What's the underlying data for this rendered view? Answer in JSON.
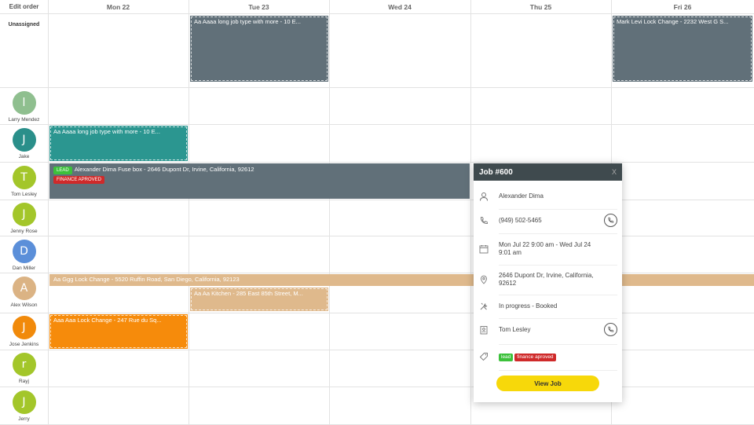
{
  "header": {
    "edit_order": "Edit order",
    "days": [
      "Mon 22",
      "Tue 23",
      "Wed 24",
      "Thu 25",
      "Fri 26"
    ]
  },
  "unassigned_label": "Unassigned",
  "technicians": [
    {
      "name": "Larry Mendez",
      "initial": "l",
      "color": "#8fbf8f"
    },
    {
      "name": "Jake",
      "initial": "J",
      "color": "#2a8f8a"
    },
    {
      "name": "Tom Lesley",
      "initial": "T",
      "color": "#a3c62a"
    },
    {
      "name": "Jenny Rose",
      "initial": "J",
      "color": "#a3c62a"
    },
    {
      "name": "Dan Miller",
      "initial": "D",
      "color": "#5b8fd9"
    },
    {
      "name": "Alex Wilson",
      "initial": "A",
      "color": "#dbb384"
    },
    {
      "name": "Jose Jenkins",
      "initial": "J",
      "color": "#f18a0b"
    },
    {
      "name": "Rayj",
      "initial": "r",
      "color": "#a3c62a"
    },
    {
      "name": "Jerry",
      "initial": "J",
      "color": "#a3c62a"
    }
  ],
  "jobs": {
    "unassigned_tue": "Aa Aaaa long job type with more - 10 E...",
    "unassigned_fri": "Mark Levi Lock Change - 2232 West G S...",
    "jake_mon": "Aa Aaaa long job type with more - 10 E...",
    "tom_job": "Alexander Dima Fuse box - 2646 Dupont Dr, Irvine, California, 92612",
    "tom_tag_lead": "LEAD",
    "tom_tag_finance": "FINANCE APROVED",
    "alex_long": "Aa Ggg Lock Change - 5520 Ruffin Road, San Diego, California, 92123",
    "alex_tue": "Aa Aa Kitchen - 285 East 85th Street, M...",
    "jose_mon": "Aaa Aaa Lock Change - 247 Rue du Sq..."
  },
  "colors": {
    "slate": "#617079",
    "teal": "#2b9690",
    "tan": "#dfb98c",
    "orange": "#f68b0b",
    "accent_yellow": "#f7d80a"
  },
  "popup": {
    "title": "Job #600",
    "close": "X",
    "customer": "Alexander Dima",
    "phone": "(949) 502-5465",
    "schedule": "Mon Jul 22 9:00 am - Wed Jul 24 9:01 am",
    "address": "2646 Dupont Dr, Irvine, California, 92612",
    "status": "In progress - Booked",
    "technician": "Tom Lesley",
    "tags": [
      "lead",
      "finance aproved"
    ],
    "view_button": "View Job"
  }
}
